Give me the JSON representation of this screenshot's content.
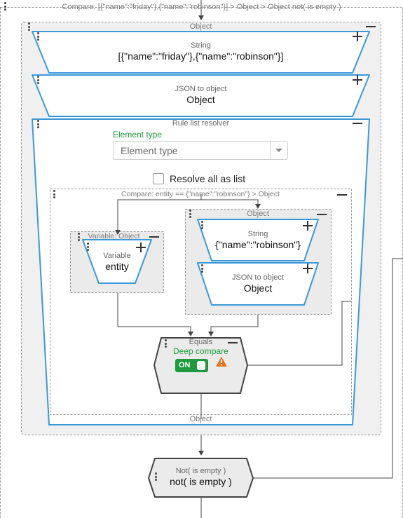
{
  "outer_title": "Compare: [{\"name\":\"friday\"},{\"name\":\"robinson\"}] > Object > Object not( is empty )",
  "object_group": {
    "title": "Object",
    "footer": "Object"
  },
  "string_block": {
    "type_label": "String",
    "value": "[{\"name\":\"friday\"},{\"name\":\"robinson\"}]"
  },
  "json_block": {
    "type_label": "JSON to object",
    "value": "Object"
  },
  "rule_list": {
    "type_label": "Rule list resolver",
    "element_type_label": "Element type",
    "element_type_placeholder": "Element type",
    "resolve_all_label": "Resolve all as list"
  },
  "inner_compare": {
    "title": "Compare: entity == {\"name\":\"robinson\"} > Object"
  },
  "variable_group": {
    "title": "Variable: Object"
  },
  "variable_block": {
    "type_label": "Variable",
    "value": "entity"
  },
  "inner_object_group": {
    "title": "Object"
  },
  "inner_string_block": {
    "type_label": "String",
    "value": "{\"name\":\"robinson\"}"
  },
  "inner_json_block": {
    "type_label": "JSON to object",
    "value": "Object"
  },
  "equals_block": {
    "type_label": "Equals",
    "deep_compare_label": "Deep compare",
    "toggle_label": "ON"
  },
  "not_block": {
    "type_label": "Not( is empty )",
    "value": "not( is empty )"
  },
  "colors": {
    "accent_blue": "#3a9ad9",
    "green": "#1e9a3c",
    "warning": "#e8711c"
  },
  "icons": [
    "drag-handle-icon",
    "plus-icon",
    "minus-icon",
    "chevron-down-icon",
    "warning-icon"
  ]
}
